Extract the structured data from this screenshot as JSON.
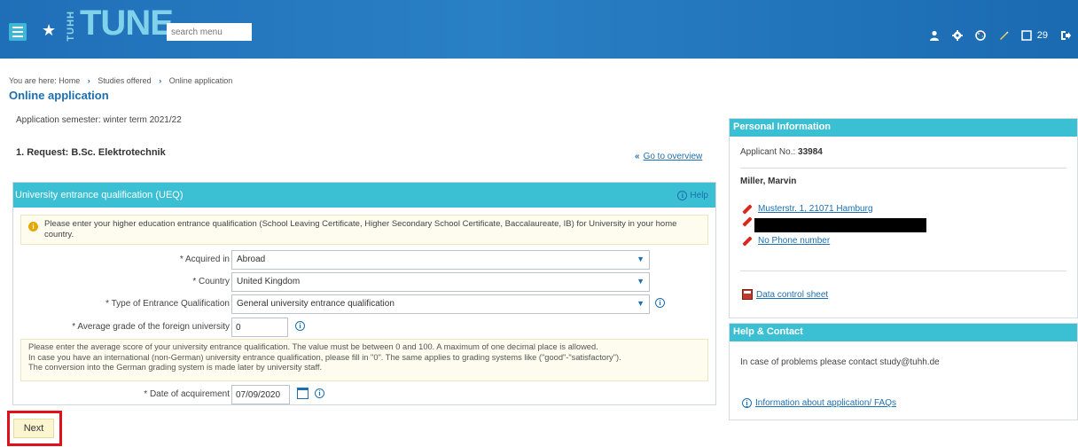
{
  "header": {
    "logo_side": "TUHH",
    "logo_main": "TUNE",
    "search_placeholder": "search menu",
    "icons": [
      "user-icon",
      "gear-icon",
      "palette-icon",
      "pen-icon",
      "window-icon",
      "logout-icon"
    ],
    "counter": "29"
  },
  "breadcrumb": {
    "prefix": "You are here:",
    "items": [
      "Home",
      "Studies offered",
      "Online application"
    ]
  },
  "page_title": "Online application",
  "main": {
    "semester": "Application semester: winter term 2021/22",
    "request": "1. Request: B.Sc. Elektrotechnik",
    "go_to_overview": "Go to overview",
    "ueq": {
      "title": "University entrance qualification (UEQ)",
      "help": "Help",
      "notice": "Please enter your higher education entrance qualification (School Leaving Certificate, Higher Secondary School Certificate, Baccalaureate, IB) for University in your home country.",
      "fields": {
        "acquired_in_label": "* Acquired in",
        "acquired_in_value": "Abroad",
        "country_label": "* Country",
        "country_value": "United Kingdom",
        "type_label": "* Type of Entrance Qualification",
        "type_value": "General university entrance qualification",
        "grade_label": "* Average grade of the foreign university",
        "grade_value": "0",
        "date_label": "* Date of acquirement",
        "date_value": "07/09/2020"
      },
      "grade_note_1": "Please enter the average score of your university entrance qualification. The value must be between 0 and 100. A maximum of one decimal place is allowed.",
      "grade_note_2": "In case you have an international (non-German) university entrance qualification, please fill in \"0\". The same applies to grading systems like (\"good\"-\"satisfactory\").",
      "grade_note_3": "The conversion into the German grading system is made later by university staff."
    },
    "next_button": "Next"
  },
  "personal_info": {
    "title": "Personal Information",
    "applicant_label": "Applicant No.:",
    "applicant_no": "33984",
    "name": "Miller, Marvin",
    "address": "Musterstr. 1, 21071 Hamburg",
    "phone": "No Phone number",
    "data_sheet": "Data control sheet"
  },
  "help_contact": {
    "title": "Help & Contact",
    "text": "In case of problems please contact  study@tuhh.de",
    "faq_link": "Information about application/ FAQs"
  },
  "colors": {
    "header": "#1f6fb8",
    "accent": "#3bbfd3",
    "link": "#1d6fb0",
    "highlight": "#e0111b"
  }
}
